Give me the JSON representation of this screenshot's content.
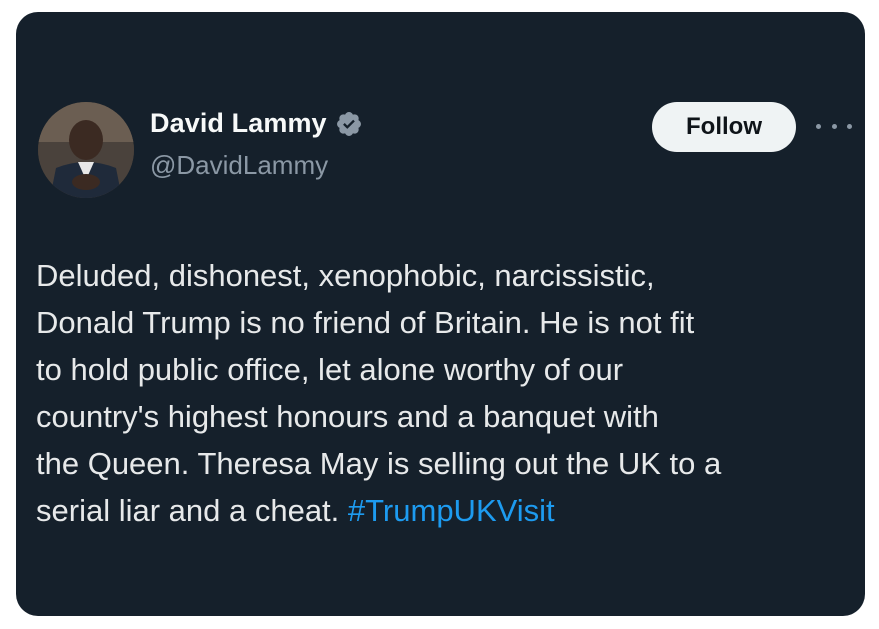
{
  "author": {
    "display_name": "David Lammy",
    "handle": "@DavidLammy",
    "verified": true,
    "avatar": "profile-photo"
  },
  "actions": {
    "follow_label": "Follow",
    "more_icon": "more-options-icon"
  },
  "tweet": {
    "text": "Deluded, dishonest, xenophobic, narcissistic,\nDonald Trump is no friend of Britain. He is not fit\nto hold public office, let alone worthy of our\ncountry's highest honours and a banquet with\nthe Queen. Theresa May is selling out the UK to a\nserial liar and a cheat. ",
    "hashtag": "#TrumpUKVisit"
  },
  "colors": {
    "background": "#15202b",
    "text": "#e7e9ea",
    "secondary": "#8b98a5",
    "link": "#1d9bf0",
    "verified": "#8b98a5"
  }
}
